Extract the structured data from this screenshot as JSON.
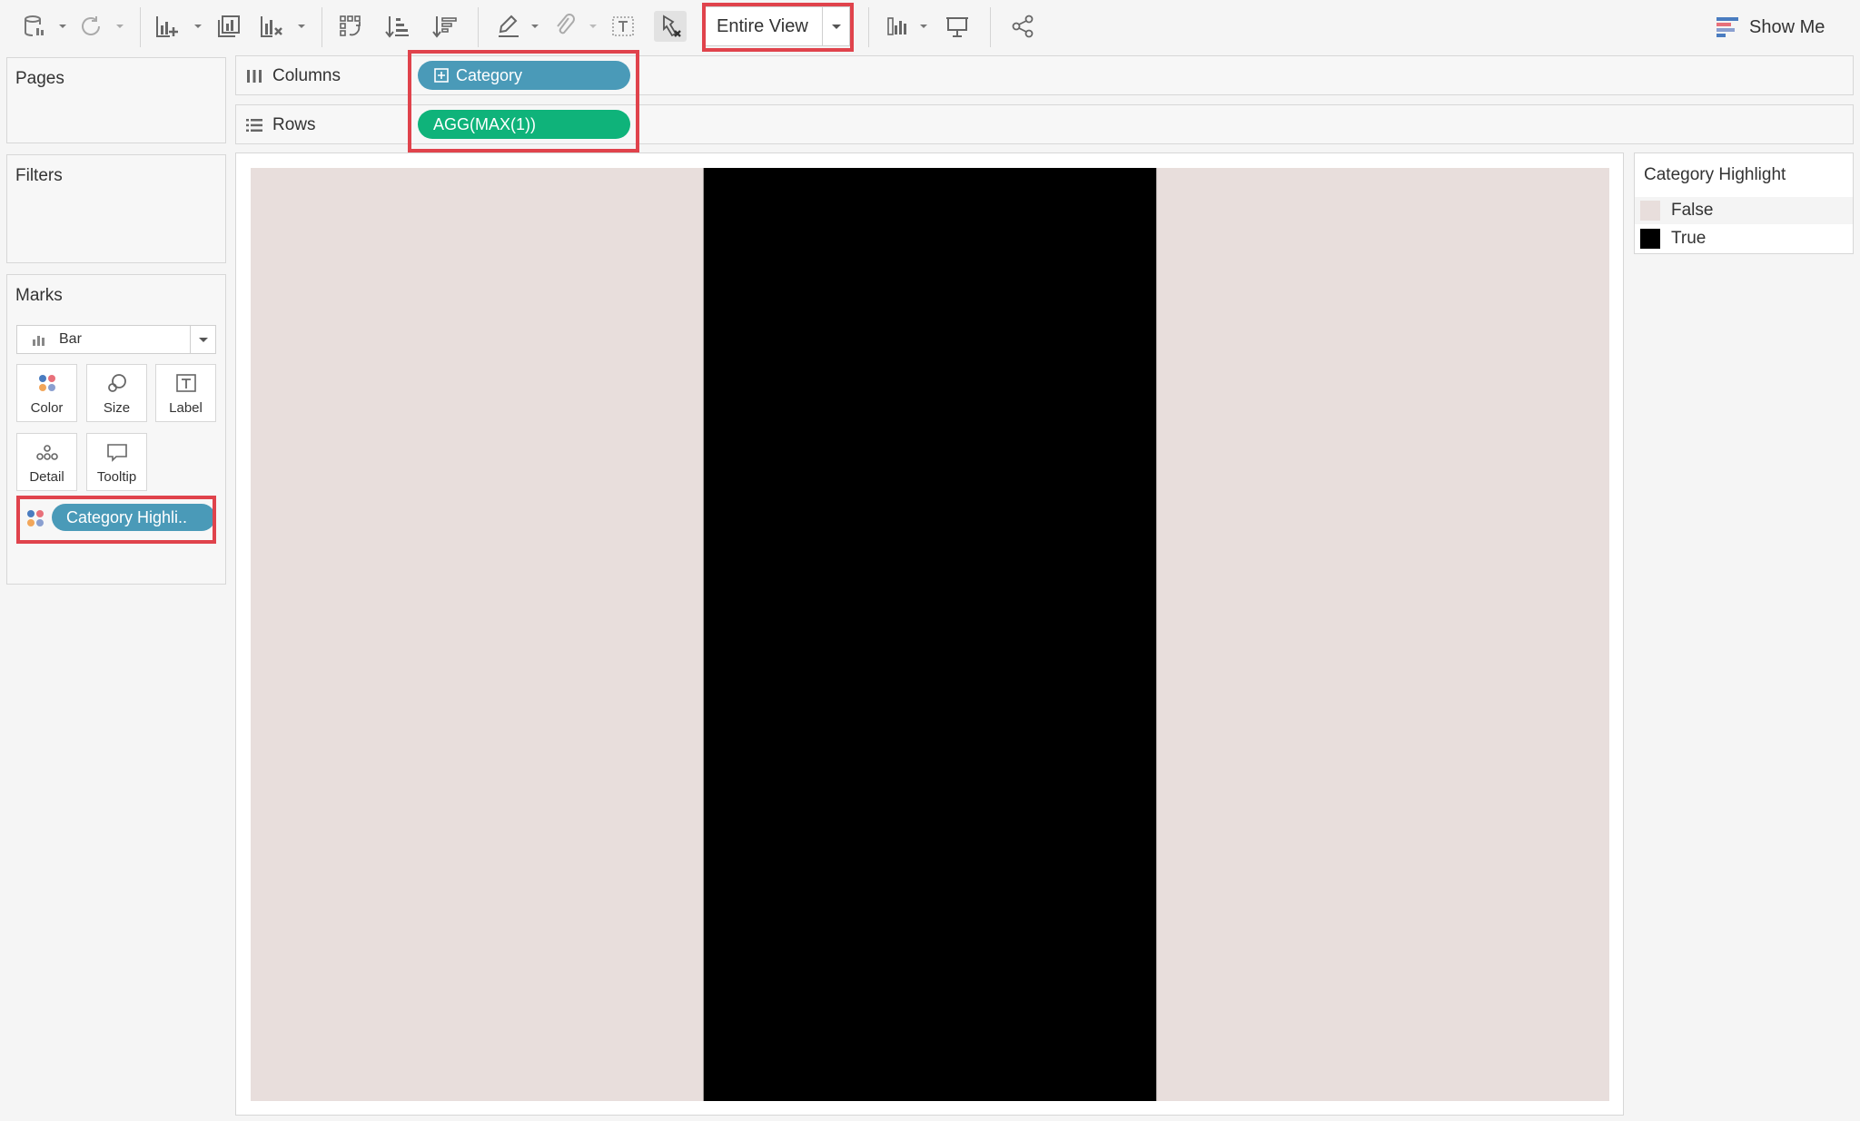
{
  "toolbar": {
    "fit_value": "Entire View",
    "show_me_label": "Show Me"
  },
  "left_panel": {
    "pages_title": "Pages",
    "filters_title": "Filters",
    "marks_title": "Marks",
    "mark_type": "Bar",
    "mark_buttons": {
      "color": "Color",
      "size": "Size",
      "label": "Label",
      "detail": "Detail",
      "tooltip": "Tooltip"
    },
    "mark_pill": "Category Highli.."
  },
  "shelves": {
    "columns_label": "Columns",
    "rows_label": "Rows",
    "columns_pill": "Category",
    "rows_pill": "AGG(MAX(1))"
  },
  "legend": {
    "title": "Category Highlight",
    "items": [
      {
        "label": "False",
        "color": "#e8dedc"
      },
      {
        "label": "True",
        "color": "#000000"
      }
    ]
  },
  "colors": {
    "accent_highlight": "#e0434c",
    "dimension_pill": "#4a9ab8",
    "measure_pill": "#0fb37a"
  },
  "chart_data": {
    "type": "bar",
    "categories": [
      "",
      "",
      ""
    ],
    "series": [
      {
        "values": [
          1,
          1,
          1
        ],
        "highlight": [
          false,
          true,
          false
        ]
      }
    ],
    "ylim": [
      0,
      1
    ],
    "grid": false,
    "legend_position": "right"
  }
}
